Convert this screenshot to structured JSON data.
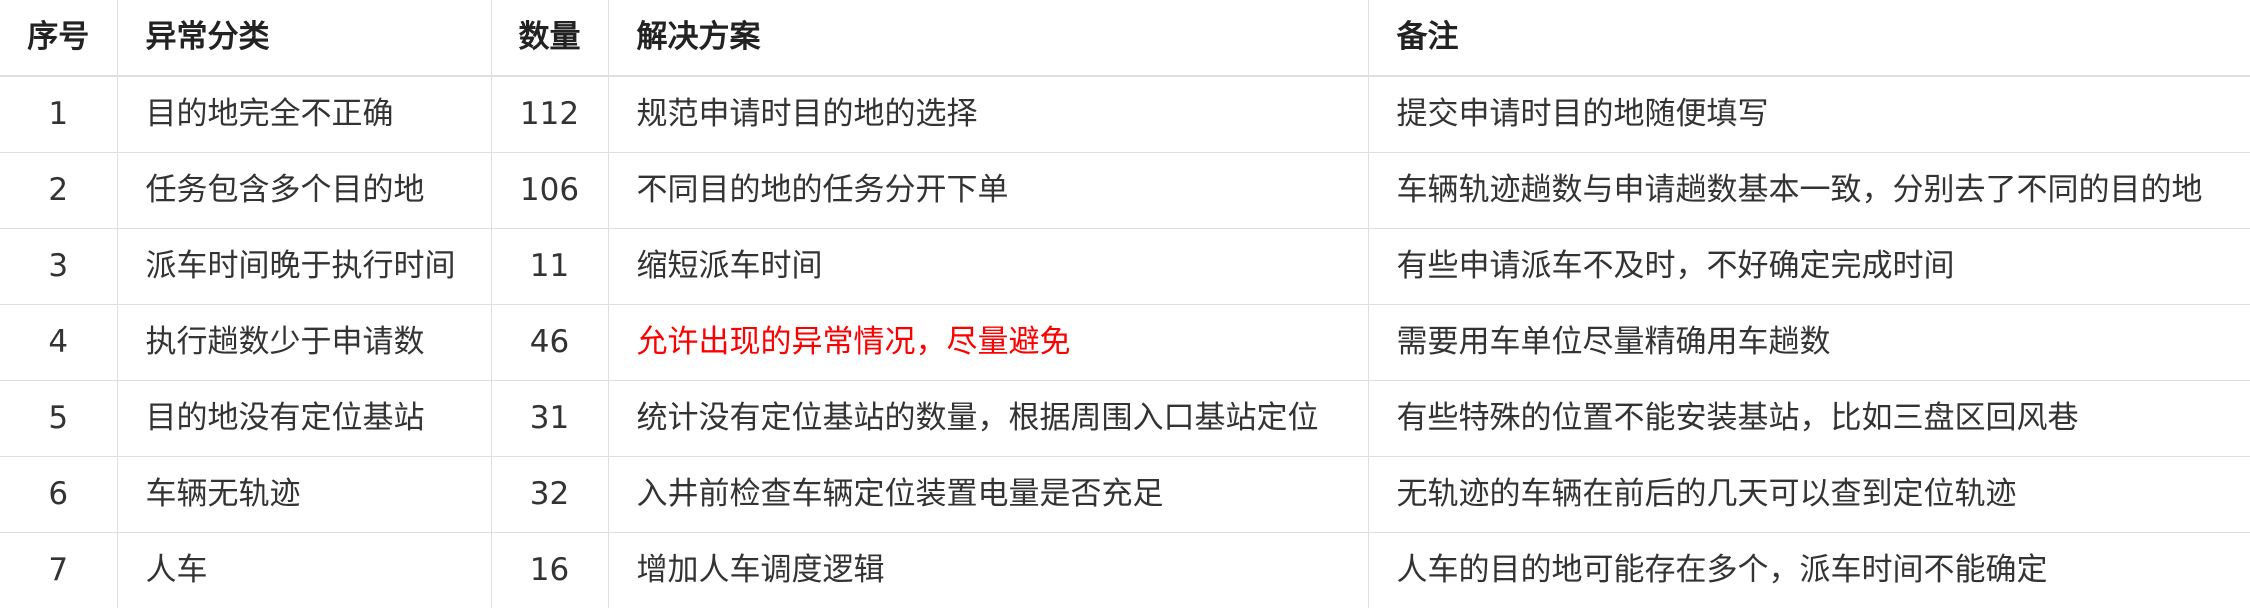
{
  "table": {
    "headers": {
      "index": "序号",
      "category": "异常分类",
      "count": "数量",
      "solution": "解决方案",
      "note": "备注"
    },
    "highlight_color": "#ff0000",
    "rows": [
      {
        "index": "1",
        "category": "目的地完全不正确",
        "count": "112",
        "solution": "规范申请时目的地的选择",
        "note": "提交申请时目的地随便填写"
      },
      {
        "index": "2",
        "category": "任务包含多个目的地",
        "count": "106",
        "solution": "不同目的地的任务分开下单",
        "note": "车辆轨迹趟数与申请趟数基本一致，分别去了不同的目的地"
      },
      {
        "index": "3",
        "category": "派车时间晚于执行时间",
        "count": "11",
        "solution": "缩短派车时间",
        "note": "有些申请派车不及时，不好确定完成时间"
      },
      {
        "index": "4",
        "category": "执行趟数少于申请数",
        "count": "46",
        "solution": "允许出现的异常情况，尽量避免",
        "note": "需要用车单位尽量精确用车趟数"
      },
      {
        "index": "5",
        "category": "目的地没有定位基站",
        "count": "31",
        "solution": "统计没有定位基站的数量，根据周围入口基站定位",
        "note": "有些特殊的位置不能安装基站，比如三盘区回风巷"
      },
      {
        "index": "6",
        "category": "车辆无轨迹",
        "count": "32",
        "solution": "入井前检查车辆定位装置电量是否充足",
        "note": "无轨迹的车辆在前后的几天可以查到定位轨迹"
      },
      {
        "index": "7",
        "category": "人车",
        "count": "16",
        "solution": "增加人车调度逻辑",
        "note": "人车的目的地可能存在多个，派车时间不能确定"
      }
    ]
  }
}
